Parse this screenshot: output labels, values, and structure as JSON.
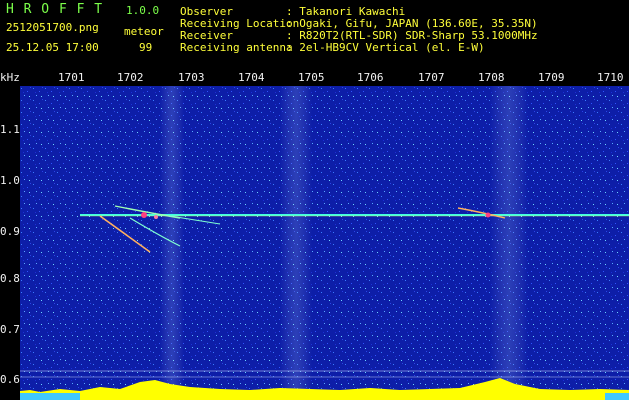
{
  "header": {
    "app_name": "H R O F F T",
    "version": "1.0.0",
    "filename": "2512051700.png",
    "datetime": "25.12.05 17:00",
    "meteor_label": "meteor",
    "meteor_count": "99",
    "info": [
      {
        "label": "Observer",
        "value": ": Takanori Kawachi"
      },
      {
        "label": "Receiving Location",
        "value": ": Ogaki, Gifu, JAPAN (136.60E, 35.35N)"
      },
      {
        "label": "Receiver",
        "value": ": R820T2(RTL-SDR) SDR-Sharp 53.1000MHz"
      },
      {
        "label": "Receiving antenna",
        "value": ": 2el-HB9CV Vertical (el. E-W)"
      }
    ]
  },
  "axis": {
    "y_unit": "kHz",
    "y_ticks": [
      "1.1",
      "1.0",
      "0.9",
      "0.8",
      "0.7",
      "0.6"
    ],
    "x_ticks": [
      "1701",
      "1702",
      "1703",
      "1704",
      "1705",
      "1706",
      "1707",
      "1708",
      "1709",
      "1710"
    ]
  },
  "colors": {
    "background": "#000000",
    "noise": "#1a2fd0",
    "carrier": "#40ffe0",
    "meteor": "#ff4080",
    "bottom_bar": "#ffff00"
  }
}
